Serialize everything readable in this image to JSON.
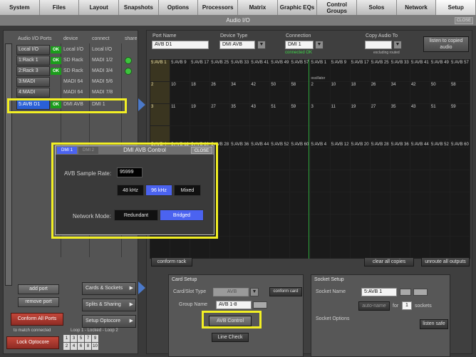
{
  "nav": {
    "tabs": [
      "System",
      "Files",
      "Layout",
      "Snapshots",
      "Options",
      "Processors",
      "Matrix",
      "Graphic EQs",
      "Control Groups",
      "Solos",
      "Network",
      "Setup"
    ]
  },
  "window": {
    "title": "Audio I/O",
    "close": "CLOSE"
  },
  "ports": {
    "headers": {
      "ports": "Audio I/O Ports",
      "device": "device",
      "connect": "connect",
      "share": "share"
    },
    "rows": [
      {
        "name": "Local I/O",
        "ok": "OK",
        "device": "Local I/O",
        "connect": "Local I/O",
        "share": false
      },
      {
        "name": "1:Rack 1",
        "ok": "OK",
        "device": "SD Rack",
        "connect": "MADI 1/2",
        "share": true
      },
      {
        "name": "2:Rack 3",
        "ok": "OK",
        "device": "SD Rack",
        "connect": "MADI 3/4",
        "share": true
      },
      {
        "name": "3:MADI",
        "ok": "",
        "device": "MADI 64",
        "connect": "MADI 5/6",
        "share": false
      },
      {
        "name": "4:MADI",
        "ok": "",
        "device": "MADI 64",
        "connect": "MADI 7/8",
        "share": false
      },
      {
        "name": "5:AVB D1",
        "ok": "OK",
        "device": "DMI AVB",
        "connect": "DMI 1",
        "share": false
      }
    ],
    "add_port": "add port",
    "remove_port": "remove port",
    "conform_all": "Conform All Ports",
    "to_match": "to match connected",
    "lock_optocore": "Lock Optocore",
    "loop_text": "Loop 1 - Locked - Loop 2",
    "loop_nums_top": [
      "1",
      "3",
      "5",
      "7",
      "9"
    ],
    "loop_nums_bottom": [
      "2",
      "4",
      "6",
      "8",
      "10"
    ]
  },
  "side_tabs": {
    "cards": "Cards & Sockets",
    "splits": "Splits & Sharing",
    "setup_opto": "Setup Optocore"
  },
  "port": {
    "name_label": "Port Name",
    "name": "AVB D1",
    "device_label": "Device Type",
    "device": "DMI AVB",
    "connection_label": "Connection",
    "connection": "DMI 1",
    "connected": "connected OK",
    "copy_label": "Copy Audio To",
    "copy_value": "",
    "excluding": "excluding routed",
    "listen_copied": "listen to copied audio"
  },
  "grid": {
    "oscillator": "oscillator",
    "col_prefix": "5:AVB ",
    "cols": [
      1,
      9,
      17,
      25,
      33,
      41,
      49,
      57,
      1,
      9,
      17,
      25,
      33,
      41,
      49,
      57
    ],
    "ctrl": {
      "conform_rack": "conform rack",
      "clear_all": "clear all copies",
      "unroute_all": "unroute all outputs"
    }
  },
  "card_setup": {
    "title": "Card Setup",
    "slot_label": "Card/Slot Type",
    "slot_value": "AVB",
    "conform_card": "conform card",
    "group_label": "Group Name",
    "group_value": "AVB 1-8",
    "avb_control": "AVB Control",
    "line_check": "Line Check"
  },
  "socket_setup": {
    "title": "Socket Setup",
    "name_label": "Socket Name",
    "name_value": "5:AVB 1",
    "auto_name": "auto-name",
    "for": "for",
    "count": "1",
    "sockets": "sockets",
    "options": "Socket Options",
    "listen_safe": "listen safe"
  },
  "popup": {
    "tab1": "DMI 1",
    "tab2": "DMI 2",
    "title": "DMI AVB Control",
    "close": "CLOSE",
    "rate_label": "AVB Sample Rate:",
    "rate_value": "95999",
    "rates": [
      "48 kHz",
      "96 kHz",
      "Mixed"
    ],
    "selected_rate": "96 kHz",
    "mode_label": "Network Mode:",
    "modes": [
      "Redundant",
      "Bridged"
    ],
    "selected_mode": "Bridged"
  },
  "colors": {
    "accent_blue": "#4b63f0",
    "ok_green": "#1b9d1b",
    "highlight_yellow": "#f2ef24"
  }
}
